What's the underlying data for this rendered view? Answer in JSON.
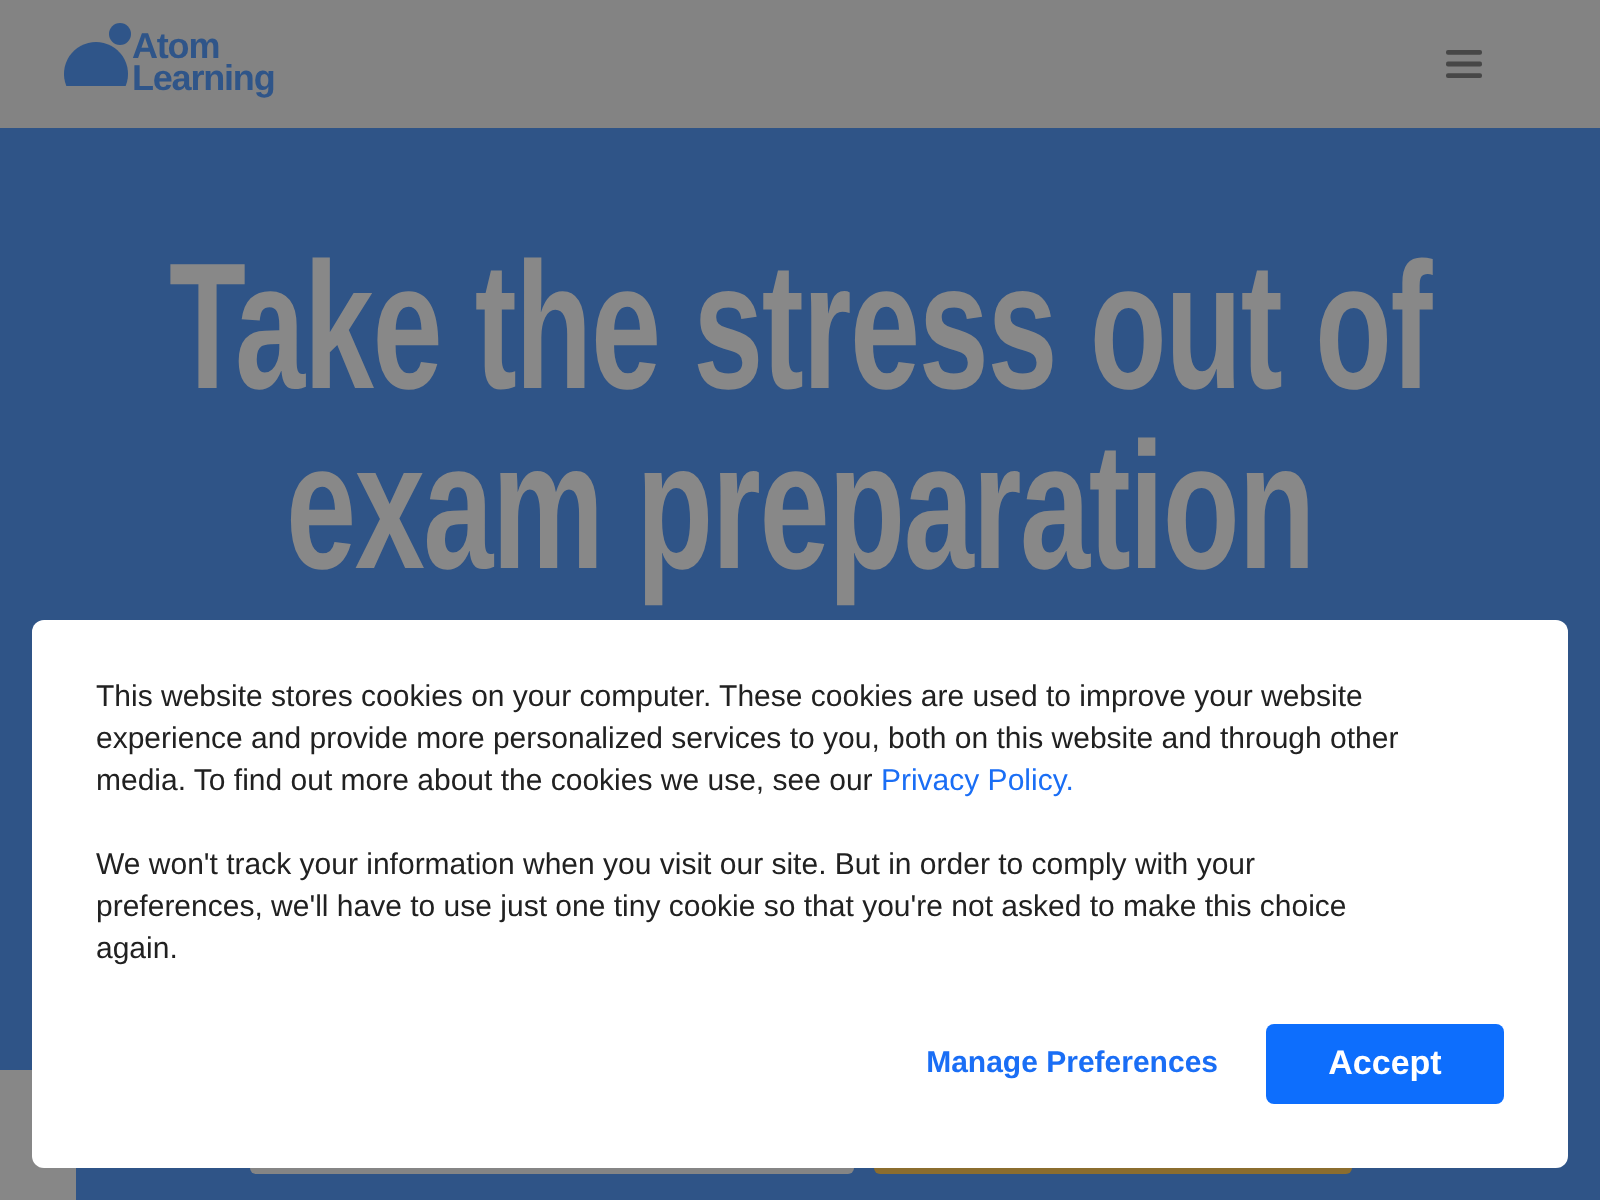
{
  "header": {
    "logo": {
      "line_1": "Atom",
      "line_2": "Learning"
    }
  },
  "hero": {
    "title": "Take the stress out of exam preparation"
  },
  "cookie_banner": {
    "paragraphs": [
      {
        "text": "This website stores cookies on your computer. These cookies are used to improve your website experience and provide more personalized services to you, both on this website and through other media. To find out more about the cookies we use, see our",
        "link": "Privacy Policy."
      },
      {
        "text": "We won't track your information when you visit our site. But in order to comply with your preferences, we'll have to use just one tiny cookie so that you're not asked to make this choice again."
      }
    ],
    "buttons": [
      {
        "label": "Manage Preferences",
        "kind": "link"
      },
      {
        "label": "Accept",
        "kind": "primary"
      }
    ]
  }
}
